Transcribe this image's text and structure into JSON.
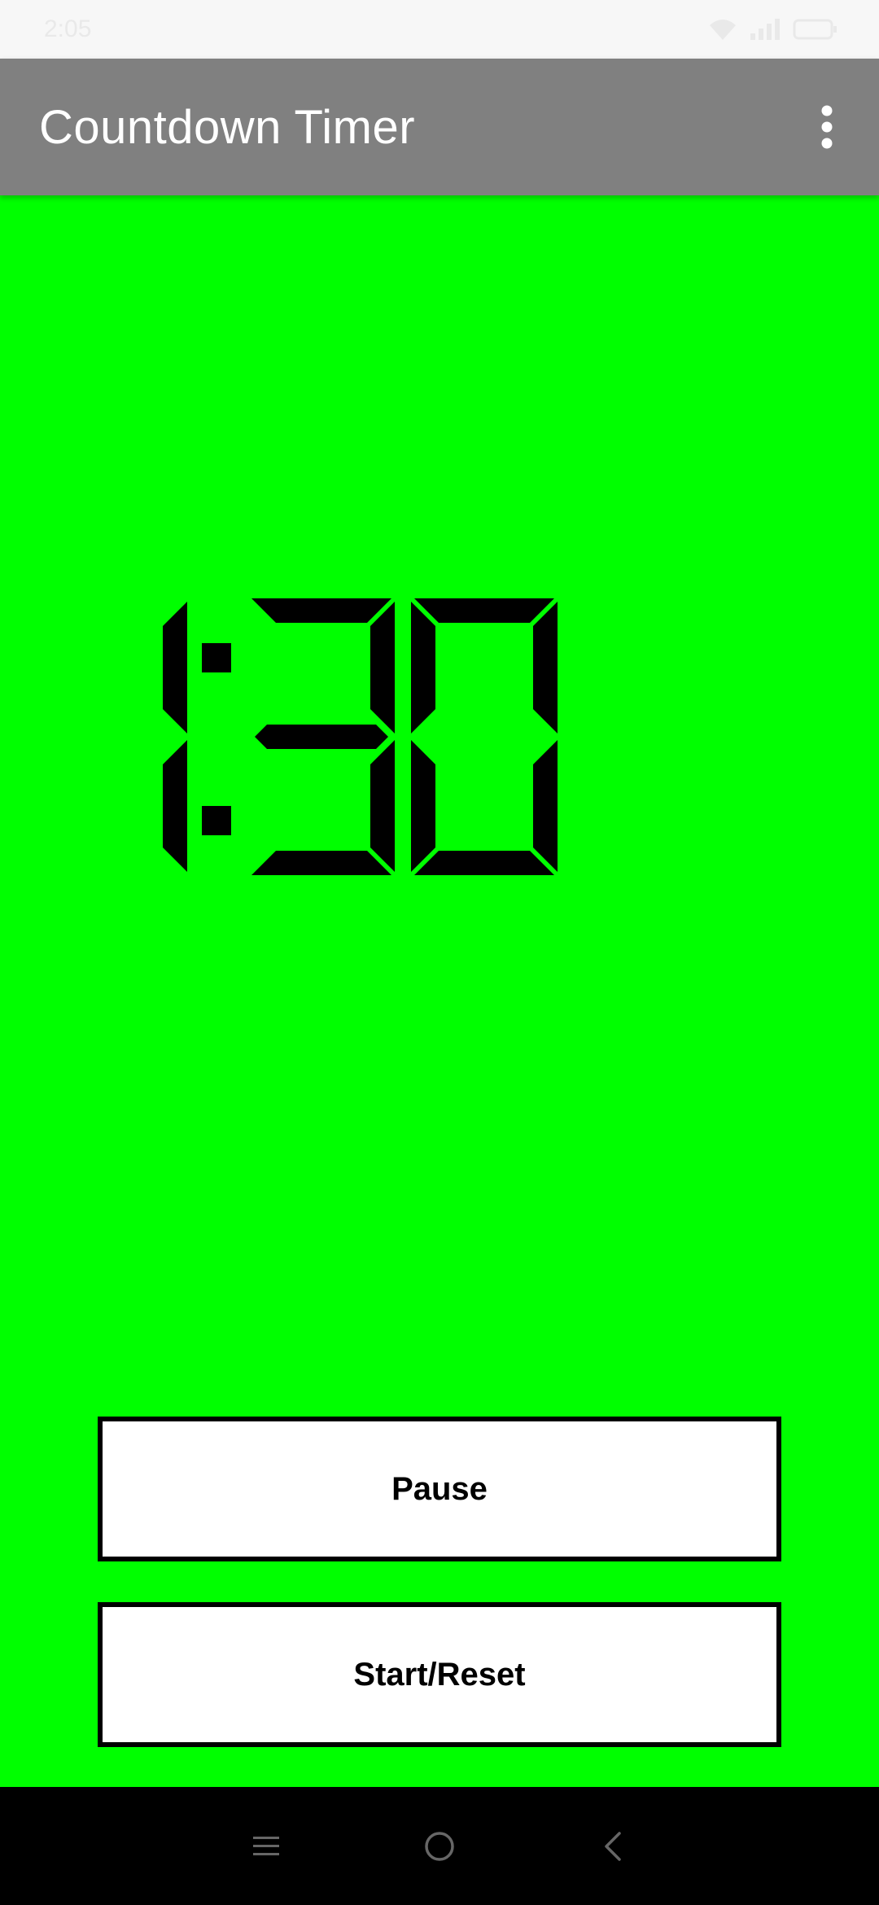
{
  "status_bar": {
    "time": "2:05",
    "icons": [
      "wifi-icon",
      "signal-icon",
      "battery-icon"
    ]
  },
  "app_bar": {
    "title": "Countdown Timer",
    "menu_icon": "more-vert-icon"
  },
  "timer": {
    "value": "1:30",
    "minutes": "1",
    "seconds": "30"
  },
  "buttons": {
    "pause_label": "Pause",
    "start_reset_label": "Start/Reset"
  },
  "nav_bar": {
    "icons": [
      "recents-icon",
      "home-icon",
      "back-icon"
    ]
  },
  "colors": {
    "background": "#00ff00",
    "app_bar": "#808080",
    "digits": "#000000"
  }
}
